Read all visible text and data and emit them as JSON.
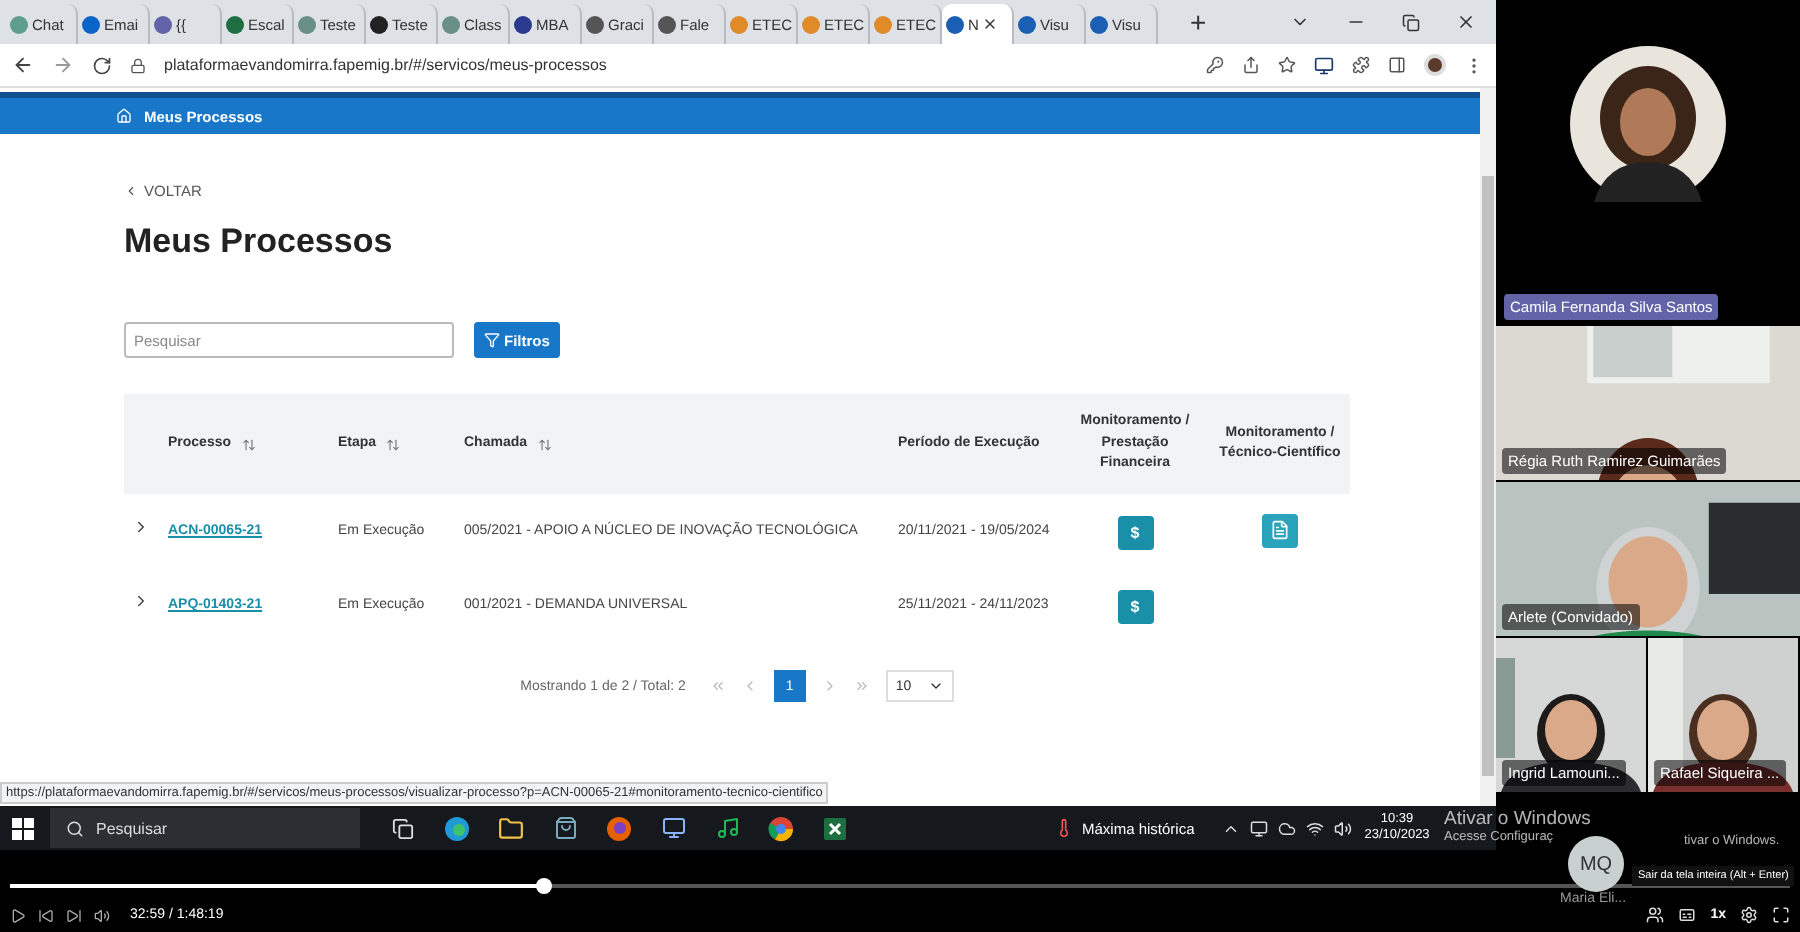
{
  "browser": {
    "tabs": [
      {
        "label": "Chat",
        "selected": false,
        "color": "#5f9e8f"
      },
      {
        "label": "Emai",
        "selected": false,
        "color": "#0a64c8"
      },
      {
        "label": "{{",
        "selected": false,
        "color": "#6264a7"
      },
      {
        "label": "Escal",
        "selected": false,
        "color": "#1d6f42"
      },
      {
        "label": "Teste",
        "selected": false,
        "color": "#6a8f86"
      },
      {
        "label": "Teste",
        "selected": false,
        "color": "#222222"
      },
      {
        "label": "Class",
        "selected": false,
        "color": "#6a8f86"
      },
      {
        "label": "MBA",
        "selected": false,
        "color": "#2b3a8f"
      },
      {
        "label": "Graci",
        "selected": false,
        "color": "#555555"
      },
      {
        "label": "Fale",
        "selected": false,
        "color": "#555555"
      },
      {
        "label": "ETEC",
        "selected": false,
        "color": "#e08a2a"
      },
      {
        "label": "ETEC",
        "selected": false,
        "color": "#e08a2a"
      },
      {
        "label": "ETEC",
        "selected": false,
        "color": "#e08a2a"
      },
      {
        "label": "N",
        "selected": true,
        "color": "#1a5fb4"
      },
      {
        "label": "Visu",
        "selected": false,
        "color": "#1a5fb4"
      },
      {
        "label": "Visu",
        "selected": false,
        "color": "#1a5fb4"
      }
    ],
    "new_tab": "+",
    "url": "plataformaevandomirra.fapemig.br/#/servicos/meus-processos",
    "status_url": "https://plataformaevandomirra.fapemig.br/#/servicos/meus-processos/visualizar-processo?p=ACN-00065-21#monitoramento-tecnico-cientifico"
  },
  "page": {
    "breadcrumb": "Meus Processos",
    "back": "VOLTAR",
    "title": "Meus Processos",
    "search": {
      "placeholder": "Pesquisar"
    },
    "filter_button": "Filtros",
    "table": {
      "columns": [
        {
          "label": "Processo",
          "sortable": true
        },
        {
          "label": "Etapa",
          "sortable": true
        },
        {
          "label": "Chamada",
          "sortable": true
        },
        {
          "label": "Período de Execução",
          "sortable": false
        },
        {
          "label": "Monitoramento / Prestação Financeira",
          "sortable": false
        },
        {
          "label": "Monitoramento / Técnico-Científico",
          "sortable": false
        }
      ],
      "rows": [
        {
          "processo": "ACN-00065-21",
          "etapa": "Em Execução",
          "chamada": "005/2021 - APOIO A NÚCLEO DE INOVAÇÃO TECNOLÓGICA",
          "periodo": "20/11/2021 - 19/05/2024",
          "financeira": "$",
          "technical_report": true
        },
        {
          "processo": "APQ-01403-21",
          "etapa": "Em Execução",
          "chamada": "001/2021 - DEMANDA UNIVERSAL",
          "periodo": "25/11/2021 - 24/11/2023",
          "financeira": "$",
          "technical_report": false
        }
      ]
    },
    "pagination": {
      "summary": "Mostrando 1 de 2 / Total: 2",
      "pages": [
        {
          "label": "1",
          "selected": true
        }
      ],
      "page_size": "10"
    }
  },
  "taskbar": {
    "search_placeholder": "Pesquisar",
    "weather": "Máxima histórica",
    "time": "10:39",
    "date": "23/10/2023"
  },
  "windows_notice": {
    "title": "Ativar o Windows",
    "line_start": "Acesse Configuraç",
    "line_end": "tivar o Windows."
  },
  "call": {
    "participants": [
      {
        "name": "Camila Fernanda Silva Santos",
        "speaking": true
      },
      {
        "name": "Régia Ruth Ramirez Guimarães",
        "speaking": false
      },
      {
        "name": "Arlete  (Convidado)",
        "speaking": false
      },
      {
        "name": "Ingrid Lamouni...",
        "speaking": false
      },
      {
        "name": "Rafael Siqueira ...",
        "speaking": false
      }
    ]
  },
  "player": {
    "level": 0.3,
    "time": "32:59 / 1:48:19",
    "speed": "1x",
    "tooltip": "Sair da tela inteira (Alt + Enter)",
    "presenter": {
      "initials": "MQ",
      "name": "Maria Eli..."
    }
  }
}
